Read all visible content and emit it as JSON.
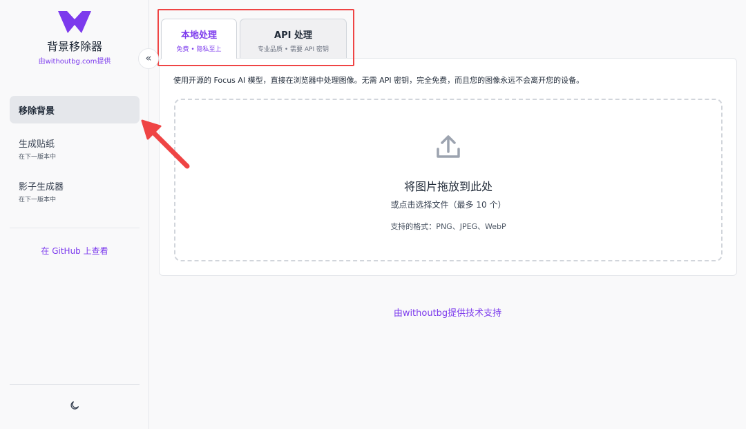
{
  "sidebar": {
    "logo_icon": "w-logo-icon",
    "app_title": "背景移除器",
    "app_subtitle": "由withoutbg.com提供",
    "collapse_label": "«",
    "items": [
      {
        "label": "移除背景",
        "sub": "",
        "active": true
      },
      {
        "label": "生成贴纸",
        "sub": "在下一版本中",
        "active": false
      },
      {
        "label": "影子生成器",
        "sub": "在下一版本中",
        "active": false
      }
    ],
    "github_link": "在 GitHub 上查看",
    "theme_icon": "moon-icon"
  },
  "tabs": [
    {
      "title": "本地处理",
      "subtitle": "免费 • 隐私至上",
      "active": true
    },
    {
      "title": "API 处理",
      "subtitle": "专业品质 • 需要 API 密钥",
      "active": false
    }
  ],
  "main": {
    "description": "使用开源的 Focus AI 模型，直接在浏览器中处理图像。无需 API 密钥，完全免费，而且您的图像永远不会离开您的设备。",
    "dropzone": {
      "icon": "upload-icon",
      "title": "将图片拖放到此处",
      "subtitle": "或点击选择文件（最多 10 个）",
      "formats": "支持的格式：PNG、JPEG、WebP"
    }
  },
  "footer": {
    "credit": "由withoutbg提供技术支持"
  },
  "colors": {
    "accent": "#7c3aed",
    "highlight_box": "#ef4444",
    "arrow": "#ef4444",
    "background": "#f9f9fa"
  }
}
